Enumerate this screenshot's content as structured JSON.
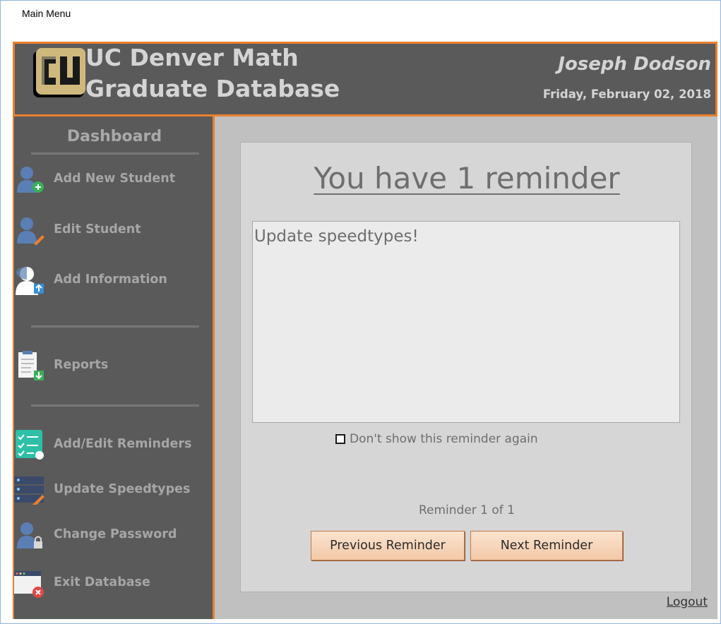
{
  "window": {
    "title": "Main Menu"
  },
  "header": {
    "title_line1": "UC Denver Math",
    "title_line2": "Graduate Database",
    "user_name": "Joseph Dodson",
    "date": "Friday, February 02, 2018",
    "logo_label": "CU"
  },
  "sidebar": {
    "title": "Dashboard",
    "items": [
      {
        "label": "Add New Student",
        "icon": "add-user-icon"
      },
      {
        "label": "Edit Student",
        "icon": "edit-user-icon"
      },
      {
        "label": "Add Information",
        "icon": "upload-user-icon"
      },
      {
        "label": "Reports",
        "icon": "report-download-icon"
      },
      {
        "label": "Add/Edit Reminders",
        "icon": "checklist-icon"
      },
      {
        "label": "Update Speedtypes",
        "icon": "server-edit-icon"
      },
      {
        "label": "Change Password",
        "icon": "user-lock-icon"
      },
      {
        "label": "Exit Database",
        "icon": "window-close-icon"
      }
    ]
  },
  "main": {
    "heading": "You have 1 reminder",
    "reminder_text": "Update speedtypes!",
    "dont_show_label": "Don't show this reminder again",
    "counter": "Reminder 1 of 1",
    "prev_button": "Previous Reminder",
    "next_button": "Next Reminder",
    "logout": "Logout"
  },
  "colors": {
    "accent": "#e8802f",
    "panel_dark": "#5a5a5a",
    "content_bg": "#c0c0c0",
    "button_fill": "#f2c9a8"
  }
}
